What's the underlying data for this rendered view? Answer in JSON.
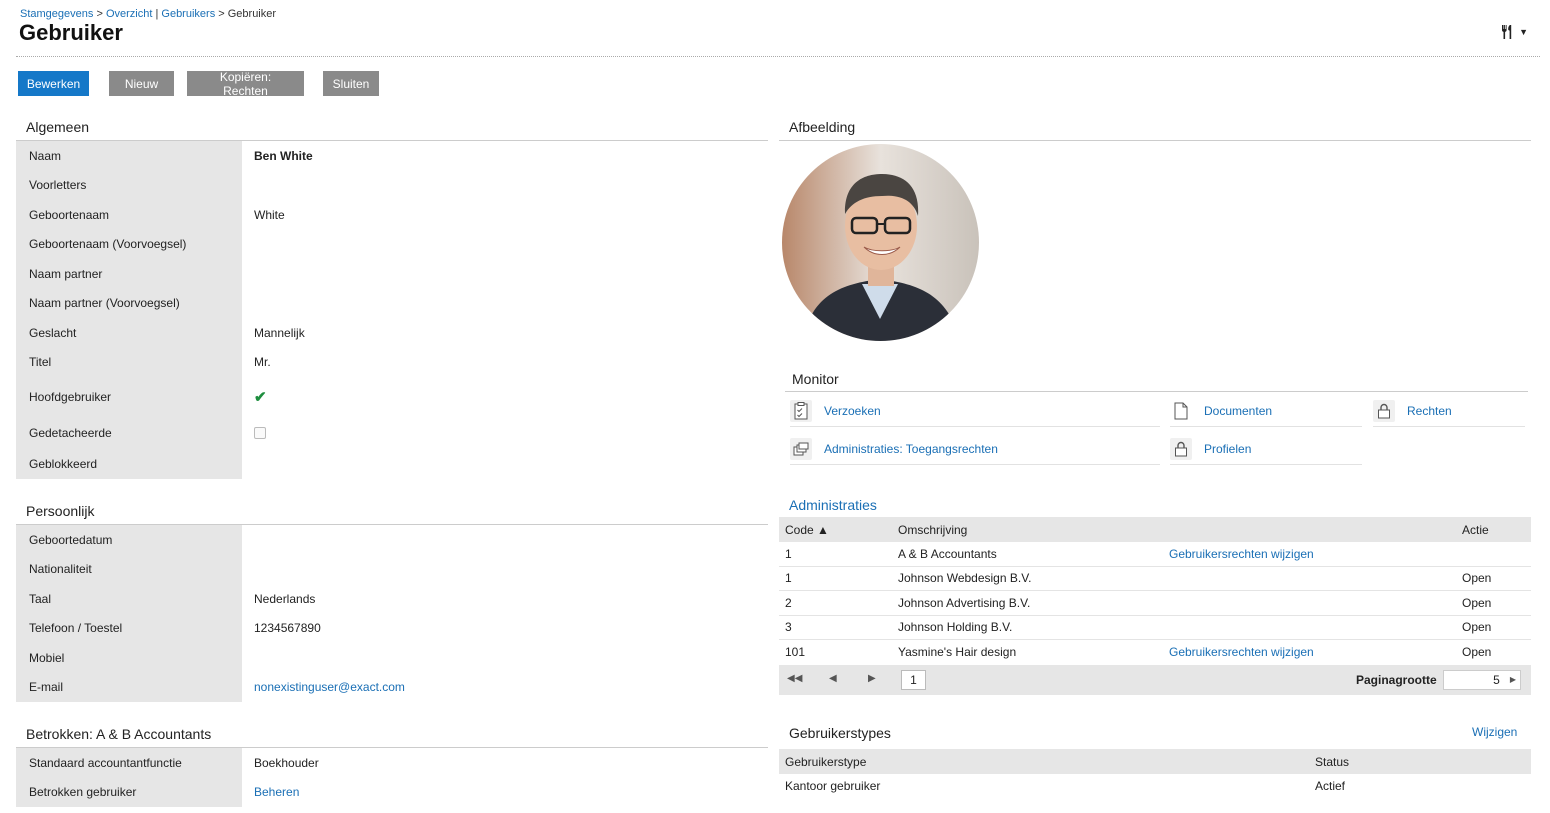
{
  "breadcrumb": {
    "part1": "Stamgegevens",
    "sep1": " > ",
    "part2": "Overzicht",
    "sep2": " | ",
    "part3": "Gebruikers",
    "sep3": " > ",
    "current": "Gebruiker"
  },
  "page_title": "Gebruiker",
  "toolbar": {
    "edit": "Bewerken",
    "new": "Nieuw",
    "copy": "Kopiëren: Rechten",
    "close": "Sluiten"
  },
  "general": {
    "title": "Algemeen",
    "rows": [
      {
        "label": "Naam",
        "value": "Ben White"
      },
      {
        "label": "Voorletters",
        "value": ""
      },
      {
        "label": "Geboortenaam",
        "value": "White"
      },
      {
        "label": "Geboortenaam (Voorvoegsel)",
        "value": ""
      },
      {
        "label": "Naam partner",
        "value": ""
      },
      {
        "label": "Naam partner (Voorvoegsel)",
        "value": ""
      },
      {
        "label": "Geslacht",
        "value": "Mannelijk"
      },
      {
        "label": "Titel",
        "value": "Mr."
      },
      {
        "label": "Hoofdgebruiker",
        "value": "✔"
      },
      {
        "label": "Gedetacheerde",
        "value": ""
      },
      {
        "label": "Geblokkeerd",
        "value": ""
      }
    ],
    "main_user_checked": true,
    "seconded_checked": false
  },
  "personal": {
    "title": "Persoonlijk",
    "rows": [
      {
        "label": "Geboortedatum",
        "value": ""
      },
      {
        "label": "Nationaliteit",
        "value": ""
      },
      {
        "label": "Taal",
        "value": "Nederlands"
      },
      {
        "label": "Telefoon / Toestel",
        "value": "1234567890"
      },
      {
        "label": "Mobiel",
        "value": ""
      },
      {
        "label": "E-mail",
        "value": "nonexistinguser@exact.com"
      }
    ]
  },
  "involved": {
    "title": "Betrokken: A & B Accountants",
    "rows": [
      {
        "label": "Standaard accountantfunctie",
        "value": "Boekhouder"
      },
      {
        "label": "Betrokken gebruiker",
        "value": "Beheren"
      }
    ]
  },
  "image": {
    "title": "Afbeelding"
  },
  "monitor": {
    "title": "Monitor",
    "items": [
      {
        "label": "Verzoeken",
        "icon": "checklist-icon"
      },
      {
        "label": "Documenten",
        "icon": "document-icon"
      },
      {
        "label": "Rechten",
        "icon": "lock-icon"
      },
      {
        "label": "Administraties: Toegangsrechten",
        "icon": "windows-icon"
      },
      {
        "label": "Profielen",
        "icon": "lock-icon"
      }
    ]
  },
  "administrations": {
    "title": "Administraties",
    "columns": {
      "code": "Code ▲",
      "description": "Omschrijving",
      "action": "Actie"
    },
    "rows": [
      {
        "code": "1",
        "description": "A & B Accountants",
        "link": "Gebruikersrechten wijzigen",
        "action": ""
      },
      {
        "code": "1",
        "description": "Johnson Webdesign B.V.",
        "link": "",
        "action": "Open"
      },
      {
        "code": "2",
        "description": "Johnson Advertising B.V.",
        "link": "",
        "action": "Open"
      },
      {
        "code": "3",
        "description": "Johnson Holding B.V.",
        "link": "",
        "action": "Open"
      },
      {
        "code": "101",
        "description": "Yasmine's Hair design",
        "link": "Gebruikersrechten wijzigen",
        "action": "Open"
      }
    ],
    "pager": {
      "page": "1",
      "page_size_label": "Paginagrootte",
      "page_size": "5"
    }
  },
  "user_types": {
    "title": "Gebruikerstypes",
    "edit_link": "Wijzigen",
    "columns": {
      "type": "Gebruikerstype",
      "status": "Status"
    },
    "rows": [
      {
        "type": "Kantoor gebruiker",
        "status": "Actief"
      }
    ]
  },
  "colors": {
    "primary_button": "#1578c8",
    "grey_button": "#8a8a8a",
    "link": "#1a6fb5",
    "label_bg": "#e6e6e6",
    "check": "#1e8e3e"
  }
}
